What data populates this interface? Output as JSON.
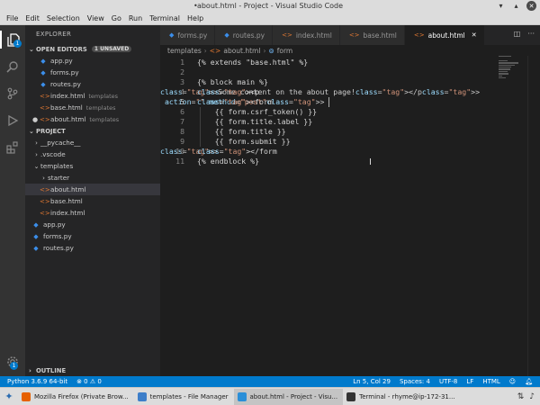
{
  "window": {
    "dirty_indicator": "•",
    "title": "about.html - Project - Visual Studio Code"
  },
  "menu": [
    "File",
    "Edit",
    "Selection",
    "View",
    "Go",
    "Run",
    "Terminal",
    "Help"
  ],
  "activity_bar": {
    "explorer_badge": "1",
    "settings_badge": "1"
  },
  "sidebar": {
    "title": "EXPLORER",
    "open_editors": {
      "label": "OPEN EDITORS",
      "unsaved_badge": "1 UNSAVED",
      "items": [
        {
          "name": "app.py",
          "desc": "",
          "type": "py",
          "dirty": false
        },
        {
          "name": "forms.py",
          "desc": "",
          "type": "py",
          "dirty": false
        },
        {
          "name": "routes.py",
          "desc": "",
          "type": "py",
          "dirty": false
        },
        {
          "name": "index.html",
          "desc": "templates",
          "type": "html",
          "dirty": false
        },
        {
          "name": "base.html",
          "desc": "templates",
          "type": "html",
          "dirty": false
        },
        {
          "name": "about.html",
          "desc": "templates",
          "type": "html",
          "dirty": true
        }
      ]
    },
    "project": {
      "label": "PROJECT",
      "items": [
        {
          "name": "__pycache__",
          "kind": "folder-collapsed",
          "indent": 1
        },
        {
          "name": ".vscode",
          "kind": "folder-collapsed",
          "indent": 1
        },
        {
          "name": "templates",
          "kind": "folder-open",
          "indent": 1
        },
        {
          "name": "starter",
          "kind": "folder-collapsed",
          "indent": 2
        },
        {
          "name": "about.html",
          "kind": "html",
          "indent": 2,
          "selected": true
        },
        {
          "name": "base.html",
          "kind": "html",
          "indent": 2
        },
        {
          "name": "index.html",
          "kind": "html",
          "indent": 2
        },
        {
          "name": "app.py",
          "kind": "py",
          "indent": 1
        },
        {
          "name": "forms.py",
          "kind": "py",
          "indent": 1
        },
        {
          "name": "routes.py",
          "kind": "py",
          "indent": 1
        }
      ]
    },
    "outline_label": "OUTLINE"
  },
  "tabs": [
    {
      "label": "forms.py",
      "type": "py",
      "active": false
    },
    {
      "label": "routes.py",
      "type": "py",
      "active": false
    },
    {
      "label": "index.html",
      "type": "html",
      "active": false
    },
    {
      "label": "base.html",
      "type": "html",
      "active": false
    },
    {
      "label": "about.html",
      "type": "html",
      "active": true
    }
  ],
  "breadcrumb": [
    "templates",
    "about.html",
    "form"
  ],
  "editor": {
    "lines": [
      "{% extends \"base.html\" %}",
      "",
      "{% block main %}",
      "<p>Some content on the about page!</p>",
      "<form action=\"\" method=\"post\">",
      "    {{ form.csrf_token() }}",
      "    {{ form.title.label }}",
      "    {{ form.title }}",
      "    {{ form.submit }}",
      "</form>",
      "{% endblock %}"
    ],
    "line_numbers": [
      "1",
      "2",
      "3",
      "4",
      "5",
      "6",
      "7",
      "8",
      "9",
      "10",
      "11"
    ],
    "current_line": 5
  },
  "statusbar": {
    "python": "Python 3.6.9 64-bit",
    "problems": "⊗ 0 ⚠ 0",
    "position": "Ln 5, Col 29",
    "spaces": "Spaces: 4",
    "encoding": "UTF-8",
    "eol": "LF",
    "language": "HTML"
  },
  "taskbar": {
    "items": [
      {
        "label": "Mozilla Firefox (Private Brow...",
        "color": "#e66000",
        "active": false
      },
      {
        "label": "templates - File Manager",
        "color": "#3d7ec9",
        "active": false
      },
      {
        "label": "about.html - Project - Visu...",
        "color": "#2a8fd8",
        "active": true
      },
      {
        "label": "Terminal - rhyme@ip-172-31...",
        "color": "#333333",
        "active": false
      }
    ]
  },
  "colors": {
    "accent": "#007acc",
    "html_icon": "#e37933",
    "py_icon": "#3b8eea"
  }
}
